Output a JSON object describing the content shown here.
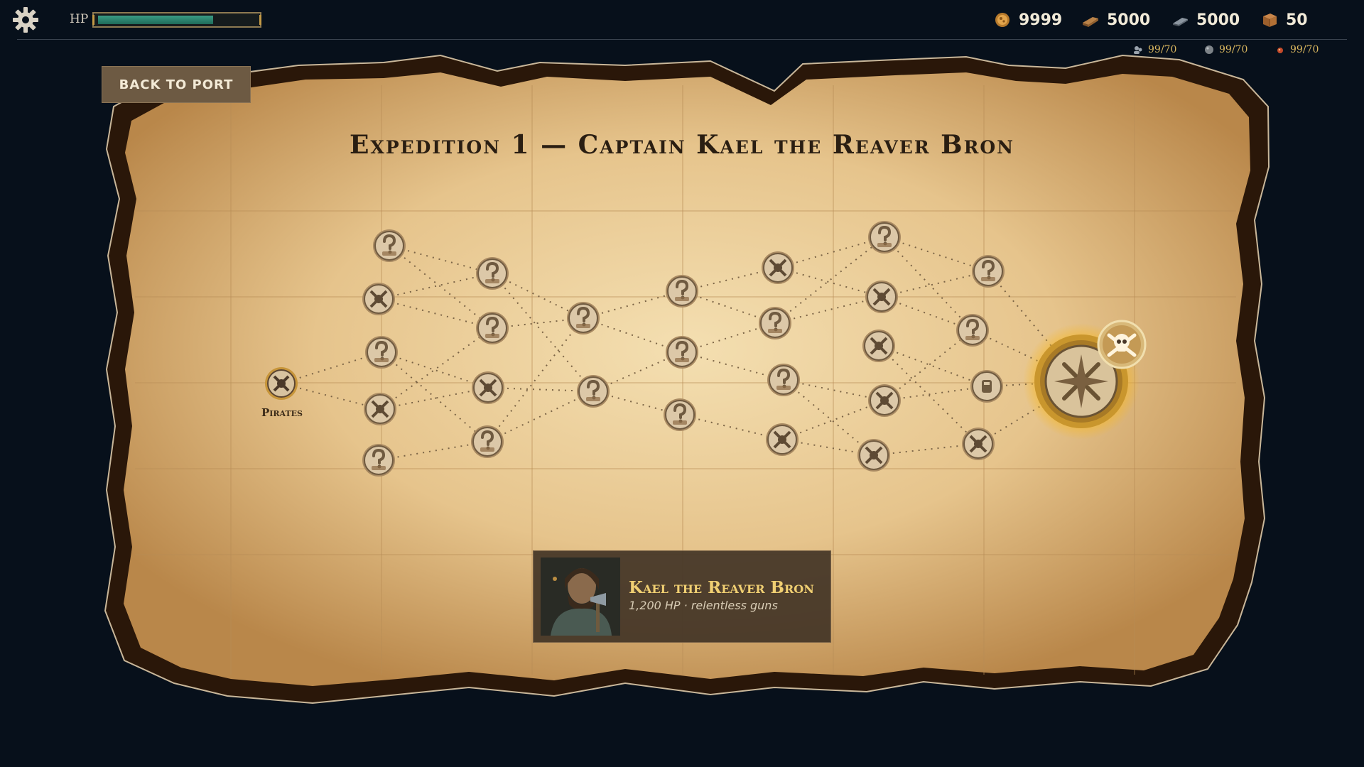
{
  "hud": {
    "hp_label": "HP",
    "hp_fraction": 0.73,
    "resources": [
      {
        "icon": "gold-coin-icon",
        "value": "9999"
      },
      {
        "icon": "wood-plank-icon",
        "value": "5000"
      },
      {
        "icon": "iron-bar-icon",
        "value": "5000"
      },
      {
        "icon": "crate-icon",
        "value": "50"
      }
    ],
    "crew": [
      {
        "icon": "crew-icon",
        "value": "99/70"
      },
      {
        "icon": "cannonball-icon",
        "value": "99/70"
      },
      {
        "icon": "ammo-icon",
        "value": "99/70"
      }
    ]
  },
  "map": {
    "back_label": "BACK TO PORT",
    "title": "Expedition 1 — Captain Kael the Reaver Bron",
    "start_label": "Pirates",
    "node_types": [
      "battle",
      "mystery",
      "shop",
      "boss",
      "start"
    ]
  },
  "boss": {
    "name": "Kael the Reaver Bron",
    "stats": "1,200 HP · relentless guns"
  },
  "colors": {
    "background": "#07101b",
    "parchment": "#e7c893",
    "ink": "#2a1e12",
    "gold": "#f0cf72",
    "hp": "#2f8a73"
  }
}
